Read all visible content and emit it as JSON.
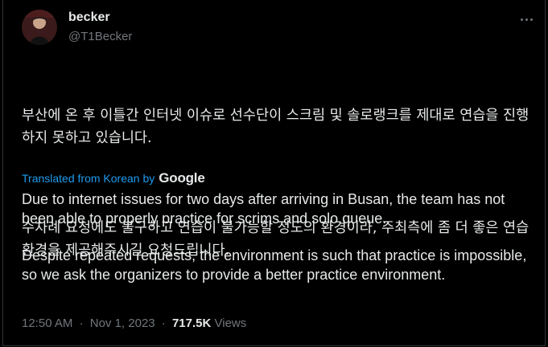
{
  "author": {
    "name": "becker",
    "handle": "@T1Becker"
  },
  "tweet": {
    "korean_p1": "부산에 온 후 이틀간 인터넷 이슈로 선수단이 스크림 및 솔로랭크를 제대로 연습을 진행하지 못하고 있습니다.",
    "korean_p2": "수차례 요청에도 불구하고 연습이 불가능할 정도의 환경이라, 주최측에 좀 더 좋은 연습 환경을 제공해주시길 요청드립니다.",
    "translated_label": "Translated from Korean by",
    "translator": "Google",
    "english_p1": "Due to internet issues for two days after arriving in Busan, the team has not been able to properly practice for scrims and solo queue.",
    "english_p2": "Despite repeated requests, the environment is such that practice is impossible, so we ask the organizers to provide a better practice environment."
  },
  "meta": {
    "time": "12:50 AM",
    "separator": "·",
    "date": "Nov 1, 2023",
    "views_count": "717.5K",
    "views_label": "Views"
  },
  "icons": {
    "more": "more-options-icon",
    "avatar": "profile-avatar"
  }
}
